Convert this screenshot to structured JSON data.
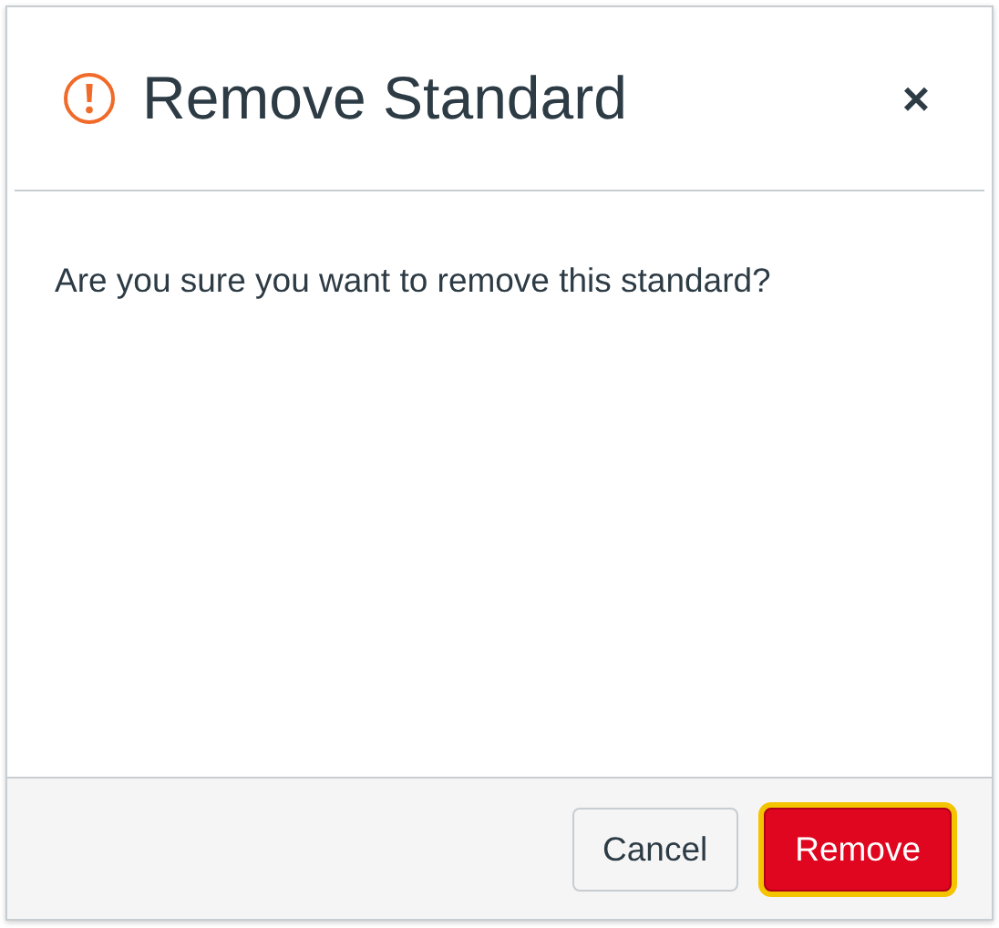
{
  "dialog": {
    "title": "Remove Standard",
    "close": "×",
    "message": "Are you sure you want to remove this standard?",
    "buttons": [
      {
        "label": "Cancel",
        "kind": "secondary",
        "focused": false
      },
      {
        "label": "Remove",
        "kind": "primary",
        "focused": true
      }
    ]
  }
}
